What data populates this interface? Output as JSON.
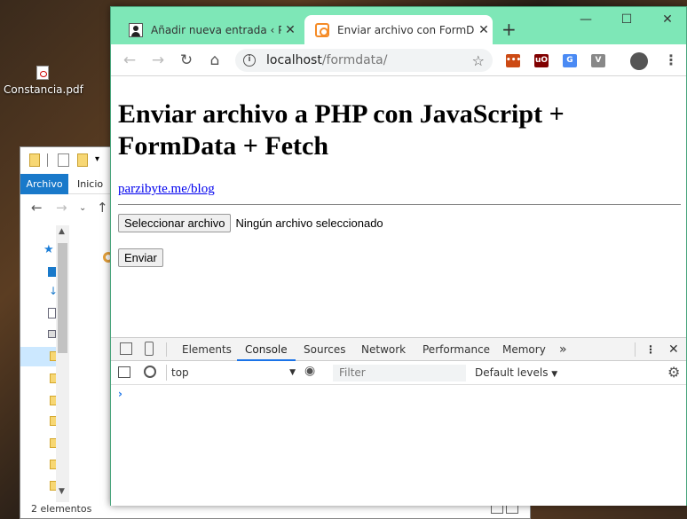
{
  "desktop": {
    "icon_label": "Constancia.pdf"
  },
  "explorer": {
    "file_tab": "Archivo",
    "home_tab": "Inicio",
    "status": "2 elementos"
  },
  "browser": {
    "tabs": [
      {
        "label": "Añadir nueva entrada ‹ Parzibyte",
        "active": false
      },
      {
        "label": "Enviar archivo con FormData",
        "active": true
      }
    ],
    "url_host": "localhost",
    "url_path": "/formdata/",
    "extensions": [
      {
        "name": "ext-dots-icon",
        "color": "#cc4a14",
        "text": "•••"
      },
      {
        "name": "ublock-icon",
        "color": "#800000",
        "text": "uO"
      },
      {
        "name": "translate-icon",
        "color": "#4a8af4",
        "text": "G"
      },
      {
        "name": "vue-devtools-icon",
        "color": "#888888",
        "text": "V"
      }
    ]
  },
  "page": {
    "heading": "Enviar archivo a PHP con JavaScript + FormData + Fetch",
    "link": "parzibyte.me/blog",
    "file_button": "Seleccionar archivo",
    "file_status": "Ningún archivo seleccionado",
    "submit": "Enviar"
  },
  "devtools": {
    "tabs": [
      "Elements",
      "Console",
      "Sources",
      "Network",
      "Performance",
      "Memory"
    ],
    "active_tab": "Console",
    "context": "top",
    "filter_placeholder": "Filter",
    "levels": "Default levels",
    "prompt": "›"
  }
}
